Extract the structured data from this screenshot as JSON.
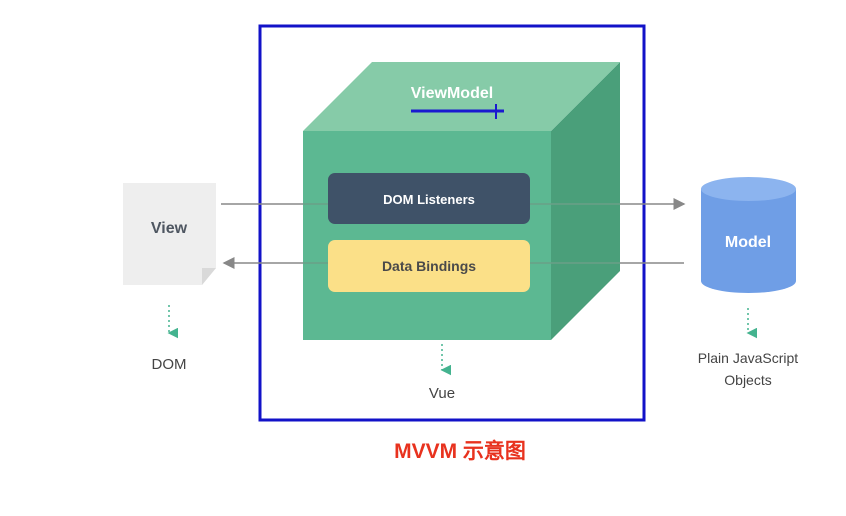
{
  "view": {
    "label": "View",
    "caption": "DOM"
  },
  "viewmodel": {
    "label": "ViewModel",
    "caption": "Vue",
    "dom_listeners_label": "DOM Listeners",
    "data_bindings_label": "Data Bindings"
  },
  "model": {
    "label": "Model",
    "caption_lines": [
      "Plain JavaScript",
      "Objects"
    ]
  },
  "figure_caption": "MVVM 示意图",
  "colors": {
    "cube_front": "#5cb892",
    "cube_top": "#86cba8",
    "cube_side": "#4a9f7a",
    "listeners_box": "#3f5268",
    "bindings_box": "#fbe088",
    "model_cylinder": "#6f9ee6",
    "view_page": "#eeeeee",
    "frame": "#1212c8",
    "caption": "#e8321e",
    "dotted_arrow": "#44b38f",
    "annotation_line": "#1a1ad0"
  }
}
